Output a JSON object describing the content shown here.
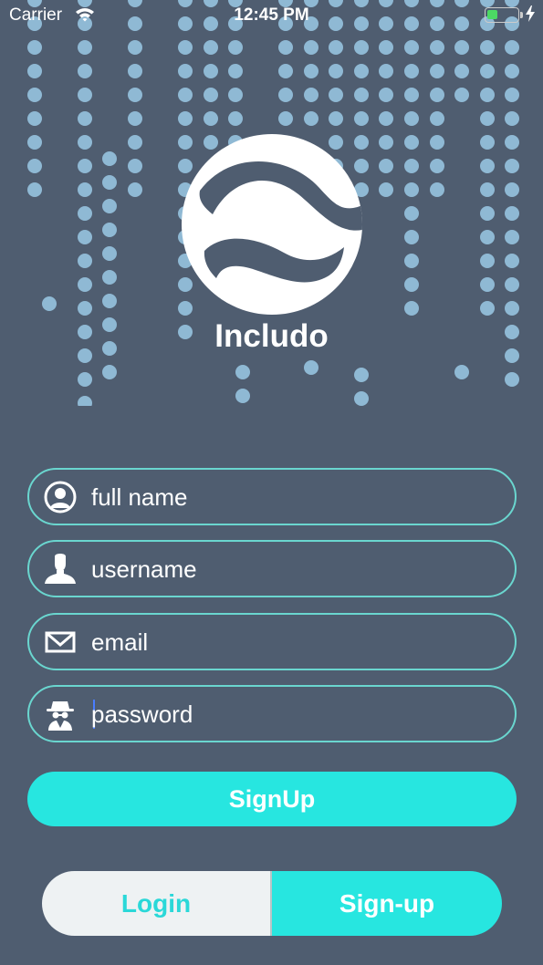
{
  "status_bar": {
    "carrier": "Carrier",
    "time": "12:45 PM",
    "battery_level": 0.35
  },
  "app": {
    "name": "Includo",
    "logo_icon": "globe-swoosh-logo"
  },
  "form": {
    "fields": [
      {
        "name": "full-name",
        "placeholder": "full name",
        "value": "",
        "icon": "user-circle-icon"
      },
      {
        "name": "username",
        "placeholder": "username",
        "value": "",
        "icon": "user-silhouette-icon"
      },
      {
        "name": "email",
        "placeholder": "email",
        "value": "",
        "icon": "envelope-icon"
      },
      {
        "name": "password",
        "placeholder": "password",
        "value": "",
        "icon": "spy-icon"
      }
    ],
    "submit_label": "SignUp"
  },
  "toggle": {
    "login_label": "Login",
    "signup_label": "Sign-up",
    "active": "Sign-up"
  },
  "colors": {
    "background": "#4f5d70",
    "accent": "#27e6e0",
    "field_border": "#6ad6cf",
    "dots": "#8fb9d4",
    "toggle_inactive": "#eef2f3"
  }
}
